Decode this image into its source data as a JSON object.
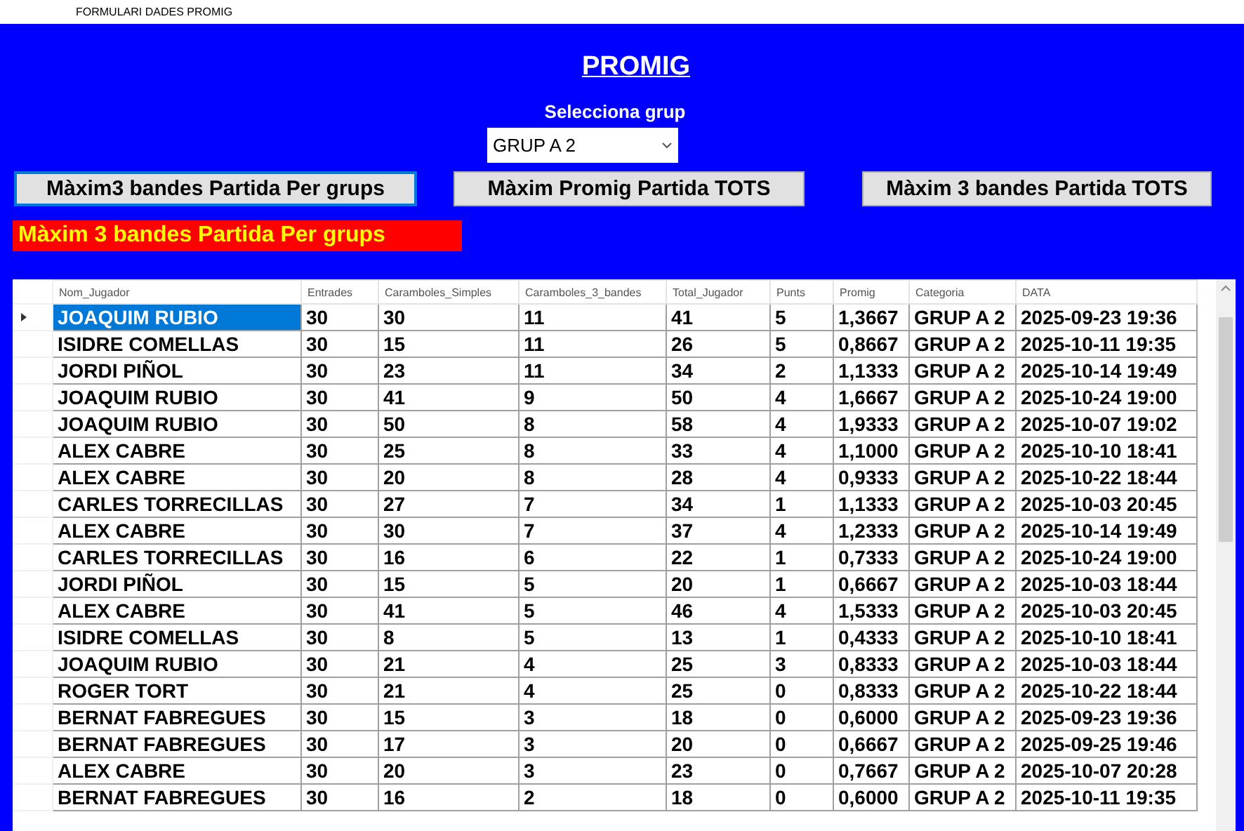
{
  "window": {
    "title": "FORMULARI DADES PROMIG"
  },
  "heading": "PROMIG",
  "group_select": {
    "label": "Selecciona grup",
    "value": "GRUP A 2"
  },
  "buttons": [
    "Màxim3 bandes Partida Per grups",
    "Màxim Promig Partida TOTS",
    "Màxim 3 bandes Partida TOTS"
  ],
  "result_label": "Màxim 3 bandes Partida Per grups",
  "table": {
    "columns": [
      "Nom_Jugador",
      "Entrades",
      "Caramboles_Simples",
      "Caramboles_3_bandes",
      "Total_Jugador",
      "Punts",
      "Promig",
      "Categoria",
      "DATA"
    ],
    "rows": [
      {
        "selected": true,
        "cells": [
          "JOAQUIM RUBIO",
          "30",
          "30",
          "11",
          "41",
          "5",
          "1,3667",
          "GRUP A 2",
          "2025-09-23 19:36"
        ]
      },
      {
        "selected": false,
        "cells": [
          "ISIDRE COMELLAS",
          "30",
          "15",
          "11",
          "26",
          "5",
          "0,8667",
          "GRUP A 2",
          "2025-10-11 19:35"
        ]
      },
      {
        "selected": false,
        "cells": [
          "JORDI PIÑOL",
          "30",
          "23",
          "11",
          "34",
          "2",
          "1,1333",
          "GRUP A 2",
          "2025-10-14 19:49"
        ]
      },
      {
        "selected": false,
        "cells": [
          "JOAQUIM RUBIO",
          "30",
          "41",
          "9",
          "50",
          "4",
          "1,6667",
          "GRUP A 2",
          "2025-10-24 19:00"
        ]
      },
      {
        "selected": false,
        "cells": [
          "JOAQUIM RUBIO",
          "30",
          "50",
          "8",
          "58",
          "4",
          "1,9333",
          "GRUP A 2",
          "2025-10-07 19:02"
        ]
      },
      {
        "selected": false,
        "cells": [
          "ALEX CABRE",
          "30",
          "25",
          "8",
          "33",
          "4",
          "1,1000",
          "GRUP A 2",
          "2025-10-10 18:41"
        ]
      },
      {
        "selected": false,
        "cells": [
          "ALEX CABRE",
          "30",
          "20",
          "8",
          "28",
          "4",
          "0,9333",
          "GRUP A 2",
          "2025-10-22 18:44"
        ]
      },
      {
        "selected": false,
        "cells": [
          "CARLES TORRECILLAS",
          "30",
          "27",
          "7",
          "34",
          "1",
          "1,1333",
          "GRUP A 2",
          "2025-10-03 20:45"
        ]
      },
      {
        "selected": false,
        "cells": [
          "ALEX CABRE",
          "30",
          "30",
          "7",
          "37",
          "4",
          "1,2333",
          "GRUP A 2",
          "2025-10-14 19:49"
        ]
      },
      {
        "selected": false,
        "cells": [
          "CARLES TORRECILLAS",
          "30",
          "16",
          "6",
          "22",
          "1",
          "0,7333",
          "GRUP A 2",
          "2025-10-24 19:00"
        ]
      },
      {
        "selected": false,
        "cells": [
          "JORDI PIÑOL",
          "30",
          "15",
          "5",
          "20",
          "1",
          "0,6667",
          "GRUP A 2",
          "2025-10-03 18:44"
        ]
      },
      {
        "selected": false,
        "cells": [
          "ALEX CABRE",
          "30",
          "41",
          "5",
          "46",
          "4",
          "1,5333",
          "GRUP A 2",
          "2025-10-03 20:45"
        ]
      },
      {
        "selected": false,
        "cells": [
          "ISIDRE COMELLAS",
          "30",
          "8",
          "5",
          "13",
          "1",
          "0,4333",
          "GRUP A 2",
          "2025-10-10 18:41"
        ]
      },
      {
        "selected": false,
        "cells": [
          "JOAQUIM RUBIO",
          "30",
          "21",
          "4",
          "25",
          "3",
          "0,8333",
          "GRUP A 2",
          "2025-10-03 18:44"
        ]
      },
      {
        "selected": false,
        "cells": [
          "ROGER TORT",
          "30",
          "21",
          "4",
          "25",
          "0",
          "0,8333",
          "GRUP A 2",
          "2025-10-22 18:44"
        ]
      },
      {
        "selected": false,
        "cells": [
          "BERNAT FABREGUES",
          "30",
          "15",
          "3",
          "18",
          "0",
          "0,6000",
          "GRUP A 2",
          "2025-09-23 19:36"
        ]
      },
      {
        "selected": false,
        "cells": [
          "BERNAT FABREGUES",
          "30",
          "17",
          "3",
          "20",
          "0",
          "0,6667",
          "GRUP A 2",
          "2025-09-25 19:46"
        ]
      },
      {
        "selected": false,
        "cells": [
          "ALEX CABRE",
          "30",
          "20",
          "3",
          "23",
          "0",
          "0,7667",
          "GRUP A 2",
          "2025-10-07 20:28"
        ]
      },
      {
        "selected": false,
        "cells": [
          "BERNAT FABREGUES",
          "30",
          "16",
          "2",
          "18",
          "0",
          "0,6000",
          "GRUP A 2",
          "2025-10-11 19:35"
        ]
      }
    ]
  }
}
